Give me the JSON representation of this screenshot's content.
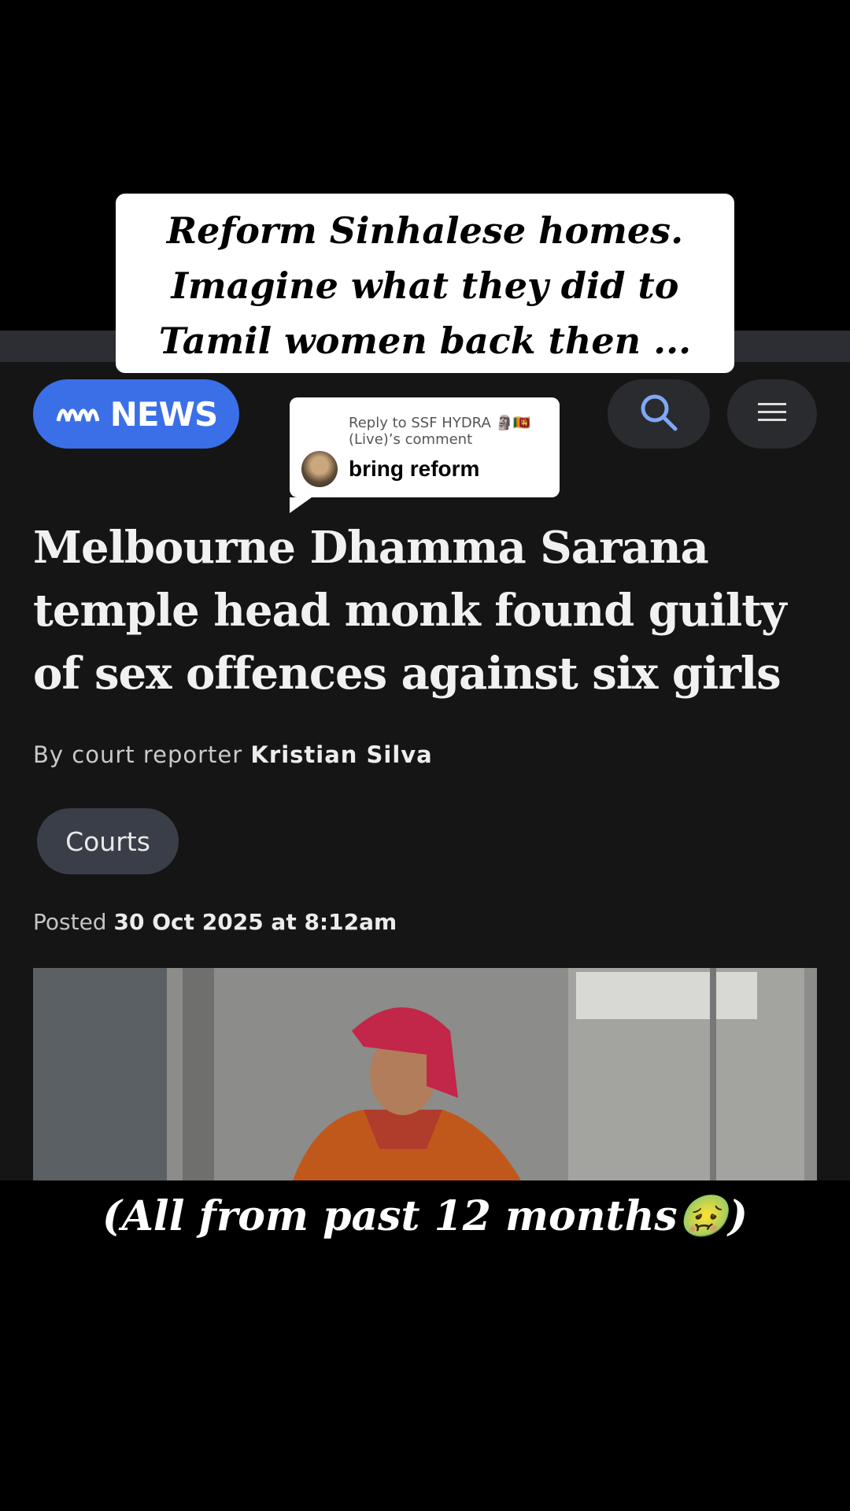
{
  "overlay": {
    "top_caption": [
      "Reform Sinhalese homes.",
      "Imagine what they did to",
      "Tamil women back then ..."
    ],
    "reply": {
      "meta": "Reply to SSF HYDRA 🗿🇱🇰 (Live)’s comment",
      "text": "bring reform"
    },
    "bottom_caption": "(All from past 12 months🤢)"
  },
  "article": {
    "brand": "NEWS",
    "headline": "Melbourne Dhamma Sarana temple head monk found guilty of sex offences against six girls",
    "byline_prefix": "By court reporter",
    "byline_name": "Kristian Silva",
    "tag": "Courts",
    "posted_prefix": "Posted",
    "posted_date": "30 Oct 2025 at 8:12am"
  },
  "icons": {
    "search": "search-icon",
    "menu": "menu-icon",
    "logo": "abc-logo-icon"
  },
  "colors": {
    "accent": "#3b6fe8",
    "background": "#151515",
    "tag_bg": "#3a3e48"
  }
}
